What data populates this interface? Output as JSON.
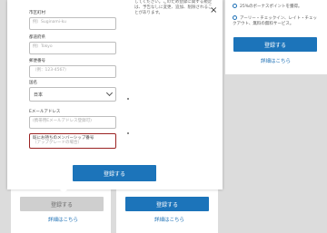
{
  "background": {
    "left_card": {
      "button": "登録する",
      "link": "詳細はこちら"
    },
    "mid_card": {
      "button": "登録する",
      "link": "詳細はこちら"
    },
    "right_card": {
      "feature1": "25%のボーナスポイントを獲得。",
      "feature2": "アーリー・チェックイン、レイト・チェックアウト、無料の無料サービス。",
      "button": "登録する",
      "link": "詳細はこちら"
    }
  },
  "modal": {
    "text": "してください。このため登録に関する規定は、予告なしに変更、追加、削除されることがあります。",
    "fields": {
      "city": {
        "label": "市区町村",
        "placeholder": "例）Suginami-ku"
      },
      "prefecture": {
        "label": "都道府県",
        "placeholder": "例）Tokyo"
      },
      "postal": {
        "label": "郵便番号",
        "placeholder": "（例：123-4567）"
      },
      "country": {
        "label": "国名",
        "value": "日本"
      },
      "email": {
        "label": "Eメールアドレス",
        "placeholder": "(携帯用Eメールアドレス登録可)"
      },
      "membership": {
        "label": "既にお持ちのメンバーシップ番号",
        "placeholder": "（アップグレードの場合）"
      }
    },
    "submit": "登録する",
    "close": "×"
  }
}
